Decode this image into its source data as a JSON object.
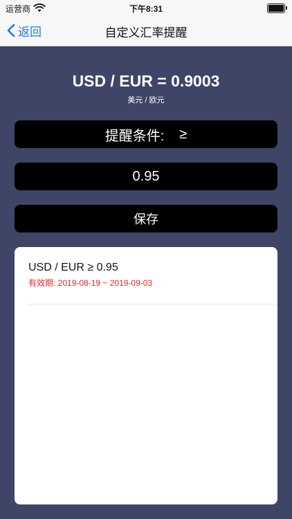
{
  "status_bar": {
    "carrier": "运营商",
    "time": "下午8:31"
  },
  "nav": {
    "back_label": "返回",
    "title": "自定义汇率提醒"
  },
  "rate": {
    "pair_value": "USD / EUR = 0.9003",
    "pair_chinese": "美元 / 欧元"
  },
  "condition": {
    "label": "提醒条件:",
    "symbol": "≥"
  },
  "threshold_input": {
    "value": "0.95"
  },
  "save_label": "保存",
  "alerts": [
    {
      "title": "USD / EUR ≥ 0.95",
      "validity": "有效期: 2019-08-19 ~ 2019-09-03"
    }
  ],
  "colors": {
    "background": "#3f4566",
    "accent": "#1a78f2",
    "validity_text": "#e0252b"
  },
  "icons": [
    "wifi-icon",
    "battery-icon",
    "chevron-left-icon"
  ]
}
